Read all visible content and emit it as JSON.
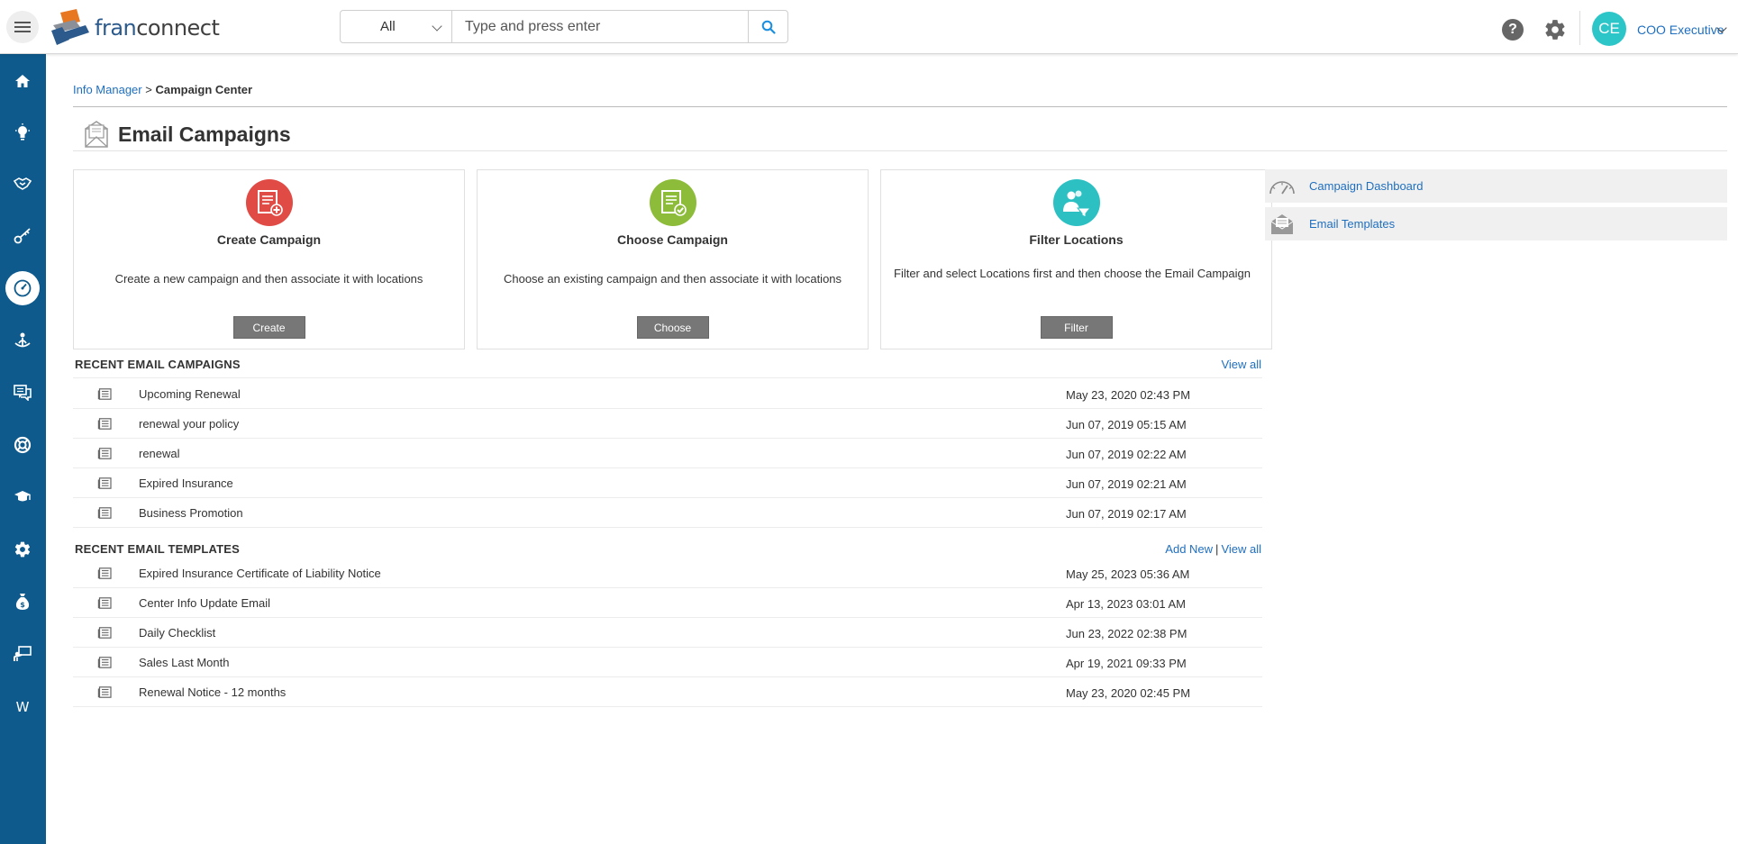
{
  "header": {
    "logo_fran": "fran",
    "logo_connect": "connect",
    "search": {
      "scope": "All",
      "placeholder": "Type and press enter"
    },
    "help_label": "?",
    "user": {
      "initials": "CE",
      "name": "COO Executive"
    }
  },
  "sidebar": {
    "items": [
      {
        "icon": "home-icon"
      },
      {
        "icon": "lightbulb-icon"
      },
      {
        "icon": "handshake-icon"
      },
      {
        "icon": "key-icon"
      },
      {
        "icon": "gauge-icon",
        "active": true
      },
      {
        "icon": "people-icon"
      },
      {
        "icon": "chat-icon"
      },
      {
        "icon": "lifebuoy-icon"
      },
      {
        "icon": "graduation-cap-icon"
      },
      {
        "icon": "gear-icon"
      },
      {
        "icon": "money-bag-icon"
      },
      {
        "icon": "presentation-icon"
      },
      {
        "icon": "w-letter-icon",
        "label": "W"
      }
    ],
    "color": "#0e5a8c"
  },
  "breadcrumb": {
    "parent": "Info Manager",
    "separator": ">",
    "current": "Campaign Center"
  },
  "page": {
    "title": "Email Campaigns"
  },
  "cards": [
    {
      "title": "Create Campaign",
      "description": "Create a new campaign and then associate it with locations",
      "button": "Create",
      "color": "#e04b45"
    },
    {
      "title": "Choose Campaign",
      "description": "Choose an existing campaign and then associate it with locations",
      "button": "Choose",
      "color": "#8dbb3a"
    },
    {
      "title": "Filter Locations",
      "description": "Filter and select Locations first and then choose the Email Campaign",
      "button": "Filter",
      "color": "#2cc0c3"
    }
  ],
  "quick_links": [
    {
      "label": "Campaign Dashboard",
      "icon": "speedometer-icon"
    },
    {
      "label": "Email Templates",
      "icon": "envelope-open-icon"
    }
  ],
  "recent_campaigns": {
    "title": "RECENT EMAIL CAMPAIGNS",
    "view_all": "View all",
    "rows": [
      {
        "name": "Upcoming Renewal",
        "date": "May 23, 2020 02:43 PM"
      },
      {
        "name": "renewal your policy",
        "date": "Jun 07, 2019 05:15 AM"
      },
      {
        "name": "renewal",
        "date": "Jun 07, 2019 02:22 AM"
      },
      {
        "name": "Expired Insurance",
        "date": "Jun 07, 2019 02:21 AM"
      },
      {
        "name": "Business Promotion",
        "date": "Jun 07, 2019 02:17 AM"
      }
    ]
  },
  "recent_templates": {
    "title": "RECENT EMAIL TEMPLATES",
    "add_new": "Add New",
    "separator": "|",
    "view_all": "View all",
    "rows": [
      {
        "name": "Expired Insurance Certificate of Liability Notice",
        "date": "May 25, 2023 05:36 AM"
      },
      {
        "name": "Center Info Update Email",
        "date": "Apr 13, 2023 03:01 AM"
      },
      {
        "name": "Daily Checklist",
        "date": "Jun 23, 2022 02:38 PM"
      },
      {
        "name": "Sales Last Month",
        "date": "Apr 19, 2021 09:33 PM"
      },
      {
        "name": "Renewal Notice - 12 months",
        "date": "May 23, 2020 02:45 PM"
      }
    ]
  }
}
